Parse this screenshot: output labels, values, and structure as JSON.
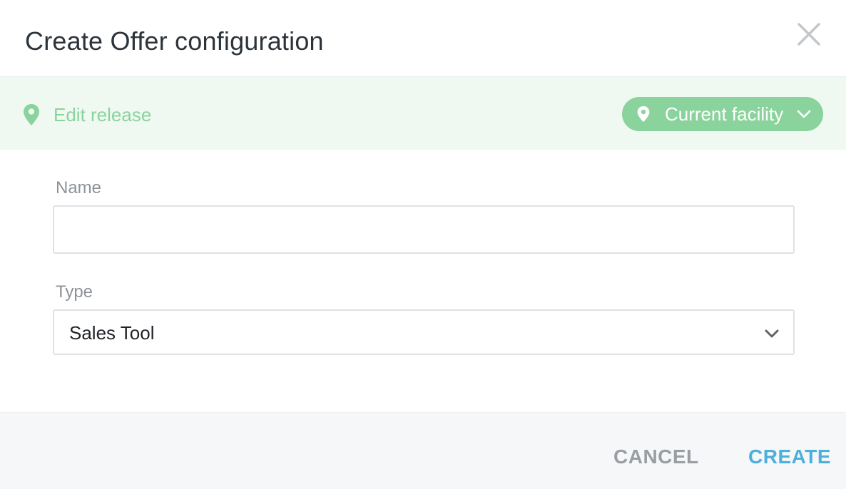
{
  "dialog": {
    "title": "Create Offer configuration",
    "close_icon": "close-icon"
  },
  "context_bar": {
    "icon": "map-pin-icon",
    "label": "Edit release",
    "facility_button": {
      "icon": "map-pin-icon",
      "label": "Current facility",
      "chevron": "chevron-down-icon"
    },
    "color": "#8bd39d",
    "background": "#eff9f1"
  },
  "form": {
    "name": {
      "label": "Name",
      "value": "",
      "placeholder": ""
    },
    "type": {
      "label": "Type",
      "selected": "Sales Tool",
      "chevron": "chevron-down-icon"
    }
  },
  "footer": {
    "cancel_label": "CANCEL",
    "create_label": "CREATE",
    "accent_color": "#4bb0dc"
  }
}
